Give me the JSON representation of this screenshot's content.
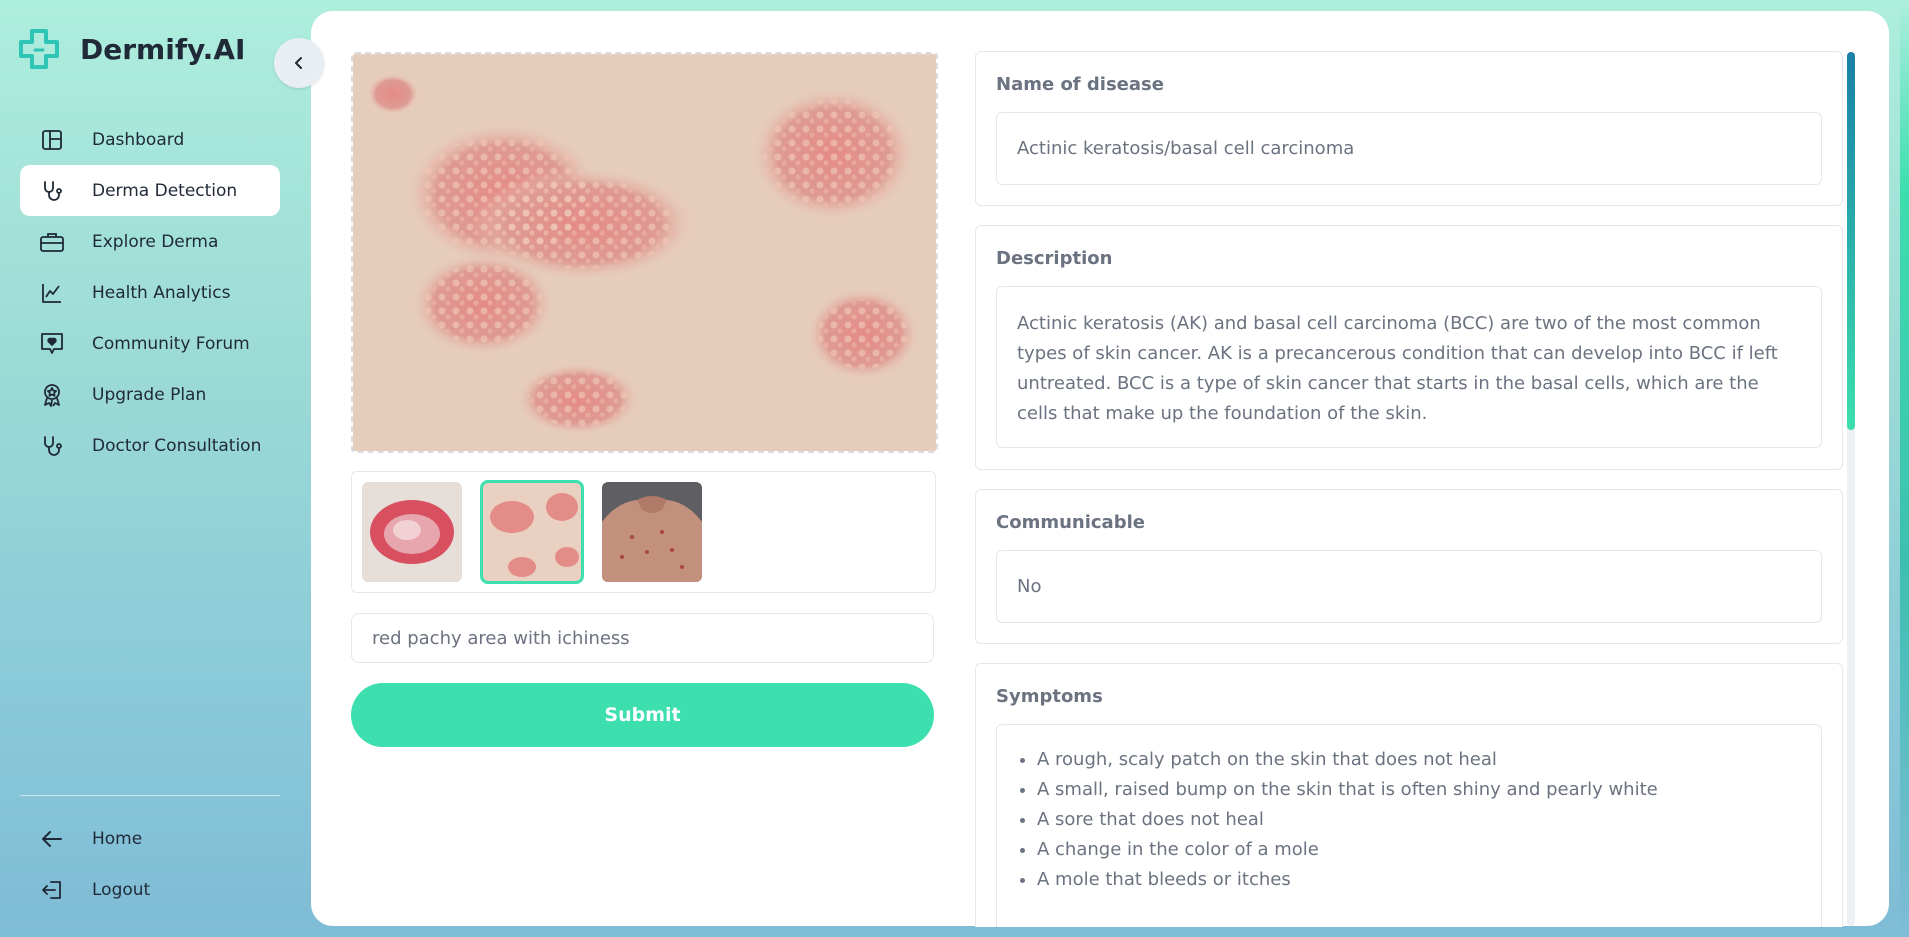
{
  "app": {
    "name": "Dermify.AI"
  },
  "sidebar": {
    "items": [
      {
        "label": "Dashboard",
        "icon": "layout-icon"
      },
      {
        "label": "Derma Detection",
        "icon": "stethoscope-icon",
        "active": true
      },
      {
        "label": "Explore Derma",
        "icon": "briefcase-icon"
      },
      {
        "label": "Health Analytics",
        "icon": "line-chart-icon"
      },
      {
        "label": "Community Forum",
        "icon": "heart-message-icon"
      },
      {
        "label": "Upgrade Plan",
        "icon": "award-icon"
      },
      {
        "label": "Doctor Consultation",
        "icon": "stethoscope-icon"
      }
    ],
    "bottom": [
      {
        "label": "Home",
        "icon": "arrow-left-icon"
      },
      {
        "label": "Logout",
        "icon": "logout-icon"
      }
    ]
  },
  "upload": {
    "selected_thumbnail": 2,
    "thumbnails": [
      "eczema-patch-image",
      "clustered-papules-image",
      "back-acne-image"
    ],
    "symptom_text": "red pachy area with ichiness",
    "submit_label": "Submit"
  },
  "result": {
    "disease": {
      "title": "Name of disease",
      "value": "Actinic keratosis/basal cell carcinoma"
    },
    "description": {
      "title": "Description",
      "value": "Actinic keratosis (AK) and basal cell carcinoma (BCC) are two of the most common types of skin cancer. AK is a precancerous condition that can develop into BCC if left untreated. BCC is a type of skin cancer that starts in the basal cells, which are the cells that make up the foundation of the skin."
    },
    "communicable": {
      "title": "Communicable",
      "value": "No"
    },
    "symptoms": {
      "title": "Symptoms",
      "items": [
        "A rough, scaly patch on the skin that does not heal",
        "A small, raised bump on the skin that is often shiny and pearly white",
        "A sore that does not heal",
        "A change in the color of a mole",
        "A mole that bleeds or itches"
      ]
    }
  },
  "colors": {
    "accent": "#3ddfae",
    "text": "#6b7280",
    "dark": "#1f2937"
  }
}
